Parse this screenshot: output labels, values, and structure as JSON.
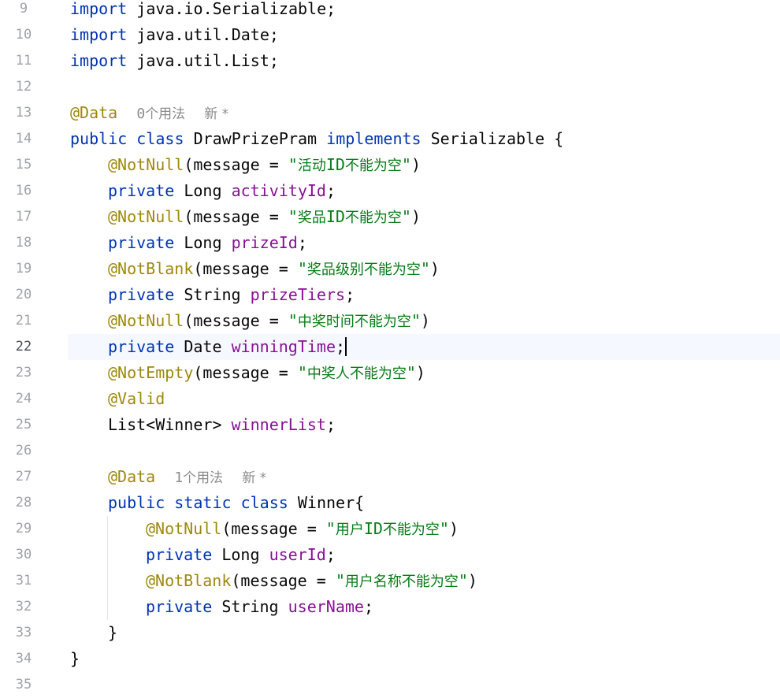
{
  "line_numbers": [
    "9",
    "10",
    "11",
    "12",
    "13",
    "14",
    "15",
    "16",
    "17",
    "18",
    "19",
    "20",
    "21",
    "22",
    "23",
    "24",
    "25",
    "26",
    "27",
    "28",
    "29",
    "30",
    "31",
    "32",
    "33",
    "34",
    "35"
  ],
  "current_line": "22",
  "code": {
    "kw": {
      "import": "import",
      "public": "public",
      "class": "class",
      "implements": "implements",
      "private": "private",
      "static": "static"
    },
    "imports": [
      "java.io.Serializable;",
      "java.util.Date;",
      "java.util.List;"
    ],
    "ann": {
      "data": "@Data",
      "notnull": "@NotNull",
      "notblank": "@NotBlank",
      "notempty": "@NotEmpty",
      "valid": "@Valid"
    },
    "hints": {
      "usage_count_0": "0",
      "usage_count_1": "1",
      "usage_text": "个用法",
      "new_text": "新 *"
    },
    "message_prefix": "(message = ",
    "close_paren": ")",
    "quote": "\"",
    "open_brace": "{",
    "close_brace": "}",
    "semicolon": ";",
    "class_name": "DrawPrizePram",
    "interface_name": "Serializable",
    "inner_class": "Winner{",
    "types": {
      "long": "Long",
      "string": "String",
      "date": "Date",
      "list": "List<Winner>"
    },
    "fields": {
      "activityId": "activityId",
      "prizeId": "prizeId",
      "prizeTiers": "prizeTiers",
      "winningTime": "winningTime",
      "winnerList": "winnerList",
      "userId": "userId",
      "userName": "userName"
    },
    "messages": {
      "activityId_a": "活动",
      "activityId_b": "ID",
      "activityId_c": "不能为空",
      "prizeId_a": "奖品",
      "prizeId_b": "ID",
      "prizeId_c": "不能为空",
      "prizeTiers": "奖品级别不能为空",
      "winningTime": "中奖时间不能为空",
      "winnerList": "中奖人不能为空",
      "userId_a": "用户",
      "userId_b": "ID",
      "userId_c": "不能为空",
      "userName": "用户名称不能为空"
    }
  }
}
